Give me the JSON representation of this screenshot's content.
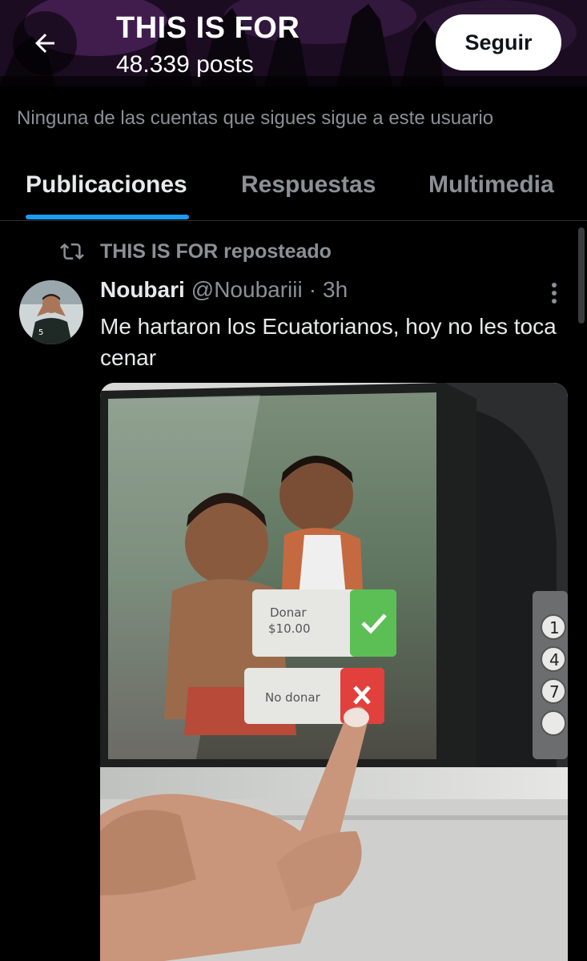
{
  "header": {
    "title": "THIS IS FOR",
    "posts_count": "48.339 posts",
    "follow_label": "Seguir"
  },
  "followers_note": "Ninguna de las cuentas que sigues sigue a este usuario",
  "tabs": [
    {
      "label": "Publicaciones",
      "active": true
    },
    {
      "label": "Respuestas",
      "active": false
    },
    {
      "label": "Multimedia",
      "active": false
    }
  ],
  "post": {
    "repost_label": "THIS IS FOR reposteado",
    "author_name": "Noubari",
    "author_handle": "@Noubariii",
    "separator": "·",
    "time": "3h",
    "text": "Me hartaron los Ecuatorianos, hoy no les toca cenar",
    "media": {
      "donate_label_line1": "Donar",
      "donate_label_line2": "$10.00",
      "no_donate_label": "No donar",
      "keypad_digits": [
        "1",
        "4",
        "7"
      ]
    }
  },
  "colors": {
    "accent": "#1d9bf0",
    "muted_text": "#8b9096",
    "primary_text": "#e7e9ea",
    "background": "#000000"
  },
  "icons": [
    "back-arrow-icon",
    "repost-icon",
    "more-options-icon",
    "check-icon",
    "x-icon"
  ]
}
